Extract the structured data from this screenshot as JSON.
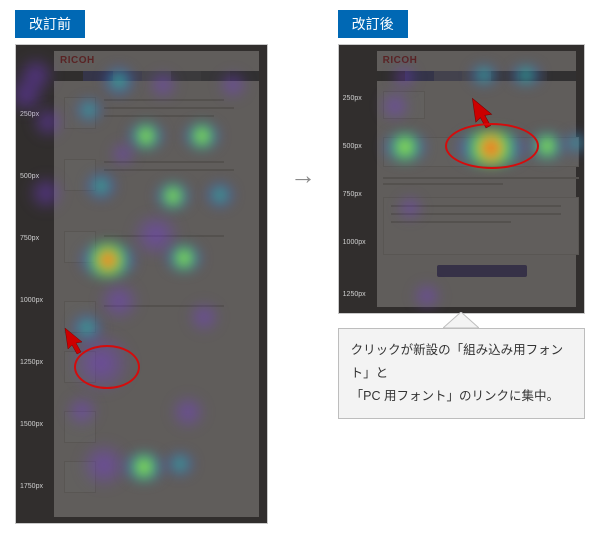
{
  "labels": {
    "before": "改訂前",
    "after": "改訂後",
    "arrow": "→"
  },
  "brand": "RICOH",
  "callout": {
    "line1": "クリックが新設の「組み込み用フォント」と",
    "line2": "「PC 用フォント」のリンクに集中。"
  },
  "ylabels_left": [
    "250px",
    "500px",
    "750px",
    "1000px",
    "1250px",
    "1500px",
    "1750px"
  ],
  "ylabels_right": [
    "250px",
    "500px",
    "750px",
    "1000px",
    "1250px"
  ]
}
